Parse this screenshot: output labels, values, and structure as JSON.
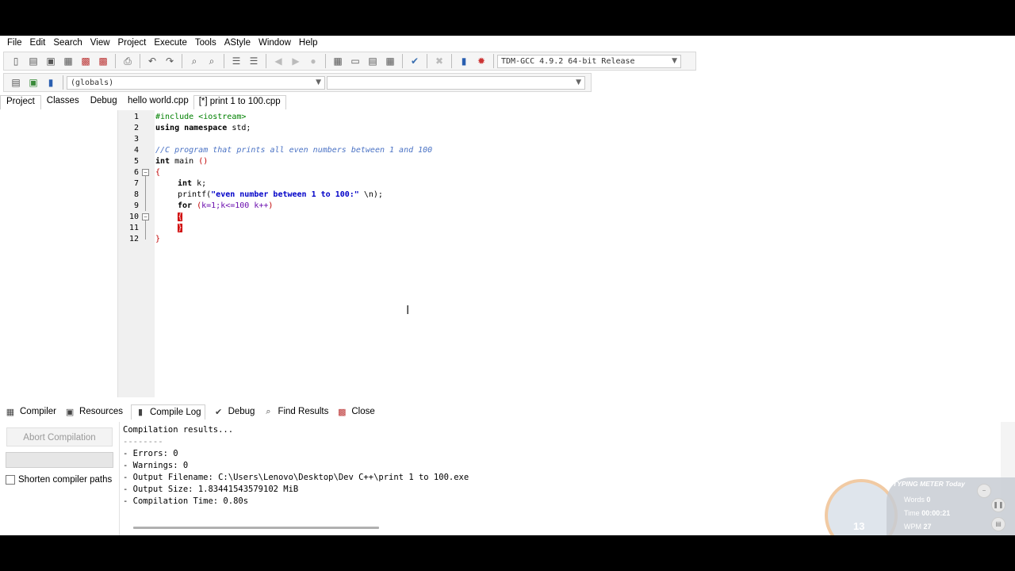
{
  "menu": [
    "File",
    "Edit",
    "Search",
    "View",
    "Project",
    "Execute",
    "Tools",
    "AStyle",
    "Window",
    "Help"
  ],
  "toolbar": {
    "compiler_select": "TDM-GCC 4.9.2 64-bit Release",
    "scope_select": "(globals)",
    "member_select": ""
  },
  "left_tabs": [
    "Project",
    "Classes",
    "Debug"
  ],
  "editor_tabs": [
    "hello world.cpp",
    "[*] print 1 to 100.cpp"
  ],
  "code": {
    "line_numbers": [
      "1",
      "2",
      "3",
      "4",
      "5",
      "6",
      "7",
      "8",
      "9",
      "10",
      "11",
      "12"
    ],
    "l1_pp": "#include <iostream>",
    "l2_kw1": "using namespace",
    "l2_rest": " std;",
    "l4_comment": "//C program that prints all even numbers between 1 and 100",
    "l5_kw": "int",
    "l5_rest": " main ",
    "l5_sym": "()",
    "l6_sym": "{",
    "l7_kw": "int",
    "l7_rest": " k;",
    "l8_fn": "printf(",
    "l8_str": "\"even number between 1 to 100:\"",
    "l8_rest": " \\n);",
    "l9_kw": "for",
    "l9_open": " (",
    "l9_expr": "k=1;k<=100 k++",
    "l9_close": ")",
    "l10_brace": "{",
    "l11_brace": "}",
    "l12_brace": "}"
  },
  "bottom_tabs": [
    "Compiler",
    "Resources",
    "Compile Log",
    "Debug",
    "Find Results",
    "Close"
  ],
  "bottom_left": {
    "abort_label": "Abort Compilation",
    "shorten_label": "Shorten compiler paths"
  },
  "log": [
    "Compilation results...",
    "--------",
    "- Errors: 0",
    "- Warnings: 0",
    "- Output Filename: C:\\Users\\Lenovo\\Desktop\\Dev C++\\print 1 to 100.exe",
    "- Output Size: 1.83441543579102 MiB",
    "- Compilation Time: 0.80s"
  ],
  "typing_meter": {
    "title": "TYPING METER Today",
    "words_label": "Words",
    "words_value": "0",
    "time_label": "Time",
    "time_value": "00:00:21",
    "wpm_label": "WPM",
    "wpm_value": "27",
    "gauge_value": "13"
  },
  "colors": {
    "current_line": "#ccf3ff",
    "comment": "#4a72c4",
    "string": "#0000c8",
    "preprocessor": "#008000"
  }
}
